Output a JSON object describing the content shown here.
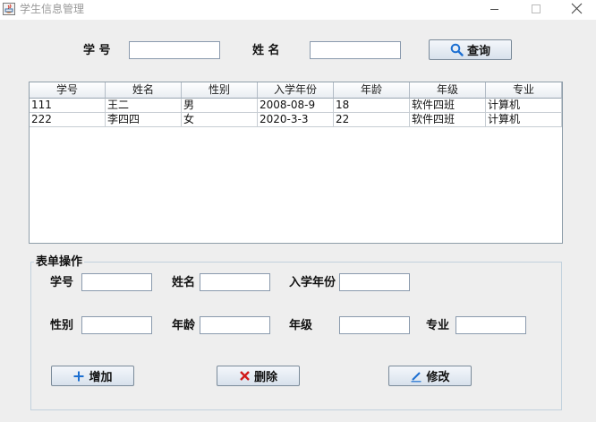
{
  "window": {
    "title": "学生信息管理",
    "buttons": [
      "minimize",
      "maximize",
      "close"
    ]
  },
  "search": {
    "id_label": "学 号",
    "name_label": "姓 名",
    "id_value": "",
    "name_value": "",
    "query_label": "查询",
    "query_icon": "search-icon"
  },
  "table": {
    "columns": [
      "学号",
      "姓名",
      "性别",
      "入学年份",
      "年龄",
      "年级",
      "专业"
    ],
    "rows": [
      [
        "111",
        "王二",
        "男",
        "2008-08-9",
        "18",
        "软件四班",
        "计算机"
      ],
      [
        "222",
        "李四四",
        "女",
        "2020-3-3",
        "22",
        "软件四班",
        "计算机"
      ]
    ]
  },
  "form": {
    "title": "表单操作",
    "fields": {
      "id": {
        "label": "学号",
        "value": ""
      },
      "name": {
        "label": "姓名",
        "value": ""
      },
      "year": {
        "label": "入学年份",
        "value": ""
      },
      "gender": {
        "label": "性别",
        "value": ""
      },
      "age": {
        "label": "年龄",
        "value": ""
      },
      "grade": {
        "label": "年级",
        "value": ""
      },
      "major": {
        "label": "专业",
        "value": ""
      }
    },
    "buttons": {
      "add": {
        "label": "增加",
        "icon": "plus-icon"
      },
      "delete": {
        "label": "删除",
        "icon": "close-icon"
      },
      "edit": {
        "label": "修改",
        "icon": "pencil-icon"
      }
    }
  },
  "colors": {
    "accent_blue": "#1c6fd1",
    "delete_red": "#d11a1a",
    "background": "#eeeeee"
  }
}
